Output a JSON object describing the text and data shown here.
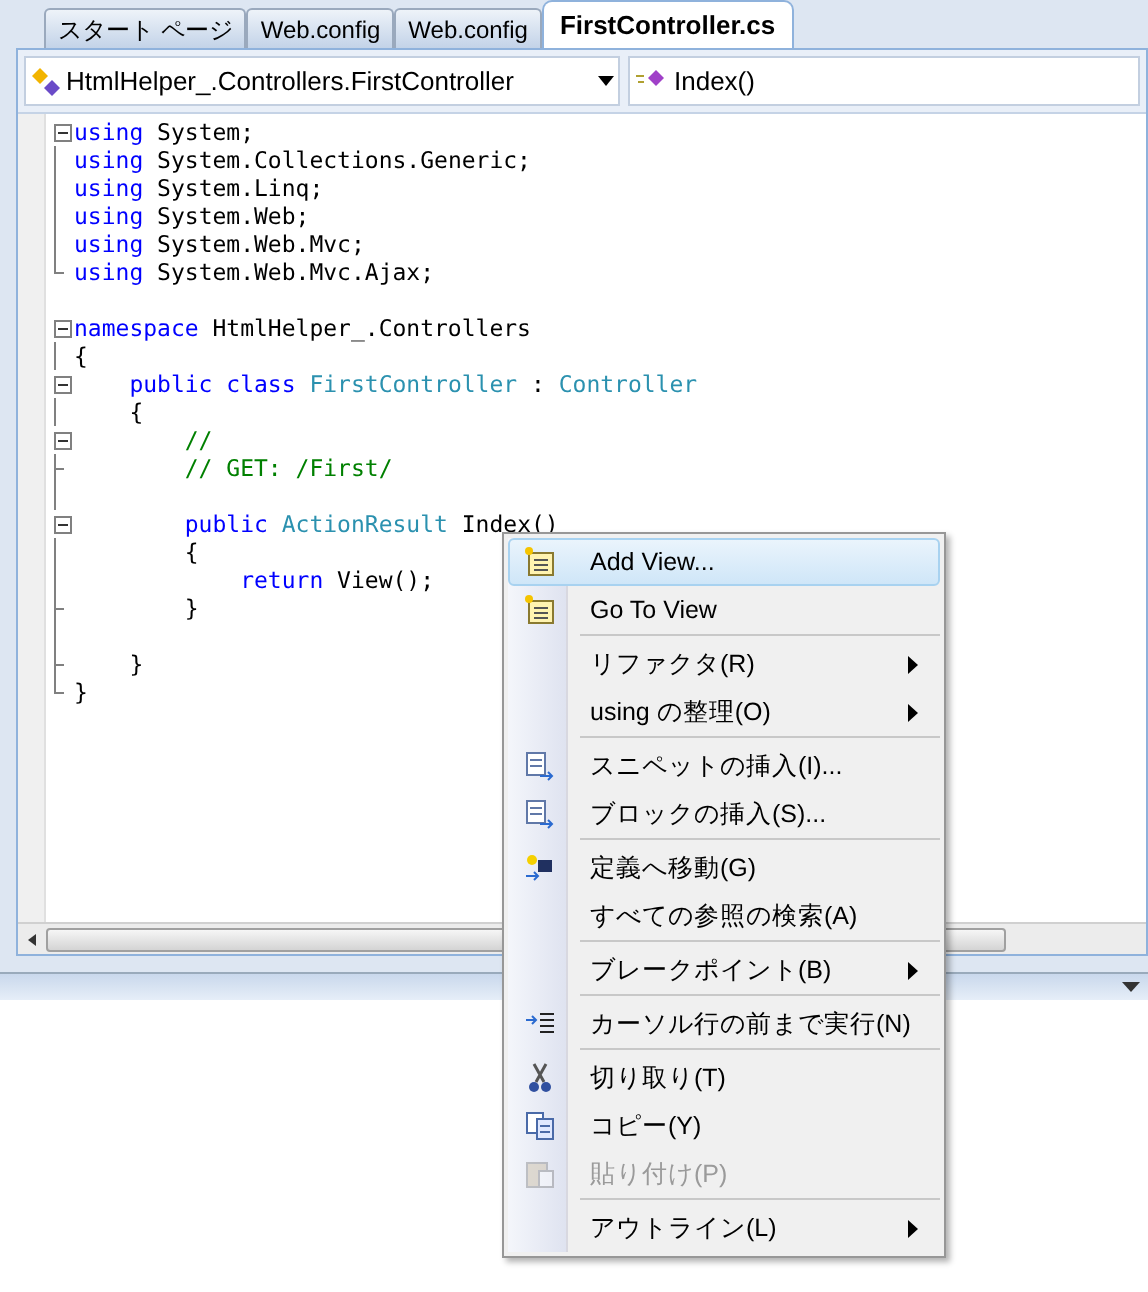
{
  "tabs": [
    {
      "label": "スタート ページ",
      "selected": false
    },
    {
      "label": "Web.config",
      "selected": false
    },
    {
      "label": "Web.config",
      "selected": false
    },
    {
      "label": "FirstController.cs",
      "selected": true
    }
  ],
  "type_dropdown": {
    "value": "HtmlHelper_.Controllers.FirstController"
  },
  "member_dropdown": {
    "value": "Index()"
  },
  "code_lines": [
    {
      "kind": "code",
      "tokens": [
        {
          "kind": "keyword",
          "text": "using"
        },
        {
          "kind": "plain",
          "text": " System;"
        }
      ]
    },
    {
      "kind": "code",
      "tokens": [
        {
          "kind": "keyword",
          "text": "using"
        },
        {
          "kind": "plain",
          "text": " System.Collections.Generic;"
        }
      ]
    },
    {
      "kind": "code",
      "tokens": [
        {
          "kind": "keyword",
          "text": "using"
        },
        {
          "kind": "plain",
          "text": " System.Linq;"
        }
      ]
    },
    {
      "kind": "code",
      "tokens": [
        {
          "kind": "keyword",
          "text": "using"
        },
        {
          "kind": "plain",
          "text": " System.Web;"
        }
      ]
    },
    {
      "kind": "code",
      "tokens": [
        {
          "kind": "keyword",
          "text": "using"
        },
        {
          "kind": "plain",
          "text": " System.Web.Mvc;"
        }
      ]
    },
    {
      "kind": "code",
      "tokens": [
        {
          "kind": "keyword",
          "text": "using"
        },
        {
          "kind": "plain",
          "text": " System.Web.Mvc.Ajax;"
        }
      ]
    },
    {
      "kind": "blank"
    },
    {
      "kind": "code",
      "tokens": [
        {
          "kind": "keyword",
          "text": "namespace"
        },
        {
          "kind": "plain",
          "text": " HtmlHelper_.Controllers"
        }
      ]
    },
    {
      "kind": "code",
      "tokens": [
        {
          "kind": "plain",
          "text": "{"
        }
      ]
    },
    {
      "kind": "code",
      "tokens": [
        {
          "kind": "keyword",
          "text": "    public class "
        },
        {
          "kind": "type",
          "text": "FirstController"
        },
        {
          "kind": "plain",
          "text": " : "
        },
        {
          "kind": "type",
          "text": "Controller"
        }
      ]
    },
    {
      "kind": "code",
      "tokens": [
        {
          "kind": "plain",
          "text": "    {"
        }
      ]
    },
    {
      "kind": "code",
      "tokens": [
        {
          "kind": "comment",
          "text": "        //"
        }
      ]
    },
    {
      "kind": "code",
      "tokens": [
        {
          "kind": "comment",
          "text": "        // GET: /First/"
        }
      ]
    },
    {
      "kind": "blank"
    },
    {
      "kind": "code",
      "tokens": [
        {
          "kind": "keyword",
          "text": "        public "
        },
        {
          "kind": "type",
          "text": "ActionResult"
        },
        {
          "kind": "plain",
          "text": " Index()"
        }
      ]
    },
    {
      "kind": "code",
      "tokens": [
        {
          "kind": "plain",
          "text": "        {"
        }
      ]
    },
    {
      "kind": "code",
      "tokens": [
        {
          "kind": "keyword",
          "text": "            return"
        },
        {
          "kind": "plain",
          "text": " View();"
        }
      ]
    },
    {
      "kind": "code",
      "tokens": [
        {
          "kind": "plain",
          "text": "        }"
        }
      ]
    },
    {
      "kind": "blank"
    },
    {
      "kind": "code",
      "tokens": [
        {
          "kind": "plain",
          "text": "    }"
        }
      ]
    },
    {
      "kind": "code",
      "tokens": [
        {
          "kind": "plain",
          "text": "}"
        }
      ]
    }
  ],
  "context_menu": [
    {
      "kind": "item",
      "label": "Add View...",
      "selected": true,
      "disabled": false,
      "submenu": false
    },
    {
      "kind": "item",
      "label": "Go To View",
      "selected": false,
      "disabled": false,
      "submenu": false
    },
    {
      "kind": "separator"
    },
    {
      "kind": "item",
      "label": "リファクタ(R)",
      "selected": false,
      "disabled": false,
      "submenu": true
    },
    {
      "kind": "item",
      "label": "using の整理(O)",
      "selected": false,
      "disabled": false,
      "submenu": true
    },
    {
      "kind": "separator"
    },
    {
      "kind": "item",
      "label": "スニペットの挿入(I)...",
      "selected": false,
      "disabled": false,
      "submenu": false
    },
    {
      "kind": "item",
      "label": "ブロックの挿入(S)...",
      "selected": false,
      "disabled": false,
      "submenu": false
    },
    {
      "kind": "separator"
    },
    {
      "kind": "item",
      "label": "定義へ移動(G)",
      "selected": false,
      "disabled": false,
      "submenu": false
    },
    {
      "kind": "item",
      "label": "すべての参照の検索(A)",
      "selected": false,
      "disabled": false,
      "submenu": false
    },
    {
      "kind": "separator"
    },
    {
      "kind": "item",
      "label": "ブレークポイント(B)",
      "selected": false,
      "disabled": false,
      "submenu": true
    },
    {
      "kind": "separator"
    },
    {
      "kind": "item",
      "label": "カーソル行の前まで実行(N)",
      "selected": false,
      "disabled": false,
      "submenu": false
    },
    {
      "kind": "separator"
    },
    {
      "kind": "item",
      "label": "切り取り(T)",
      "selected": false,
      "disabled": false,
      "submenu": false
    },
    {
      "kind": "item",
      "label": "コピー(Y)",
      "selected": false,
      "disabled": false,
      "submenu": false
    },
    {
      "kind": "item",
      "label": "貼り付け(P)",
      "selected": false,
      "disabled": true,
      "submenu": false
    },
    {
      "kind": "separator"
    },
    {
      "kind": "item",
      "label": "アウトライン(L)",
      "selected": false,
      "disabled": false,
      "submenu": true
    }
  ]
}
